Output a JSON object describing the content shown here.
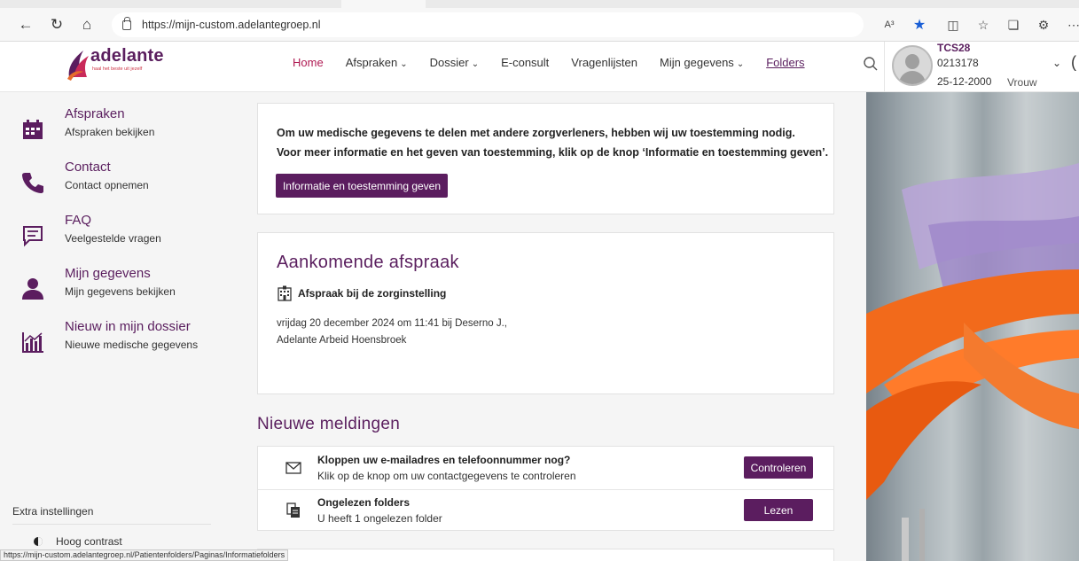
{
  "browser": {
    "url": "https://mijn-custom.adelantegroep.nl",
    "read_aloud_label": "A³"
  },
  "brand": {
    "name": "adelante",
    "tagline": "haal het beste uit jezelf",
    "accent": "#5b1d5f",
    "active_nav": "#b01a53"
  },
  "nav": {
    "home": "Home",
    "afspraken": "Afspraken",
    "dossier": "Dossier",
    "econsult": "E-consult",
    "vragenlijsten": "Vragenlijsten",
    "gegevens": "Mijn gegevens",
    "folders": "Folders"
  },
  "user": {
    "name": "TCS28",
    "id": "0213178",
    "dob": "25-12-2000",
    "gender": "Vrouw"
  },
  "sidebar": {
    "items": [
      {
        "title": "Afspraken",
        "sub": "Afspraken bekijken",
        "icon": "calendar-icon"
      },
      {
        "title": "Contact",
        "sub": "Contact opnemen",
        "icon": "phone-icon"
      },
      {
        "title": "FAQ",
        "sub": "Veelgestelde vragen",
        "icon": "chat-icon"
      },
      {
        "title": "Mijn gegevens",
        "sub": "Mijn gegevens bekijken",
        "icon": "person-icon"
      },
      {
        "title": "Nieuw in mijn dossier",
        "sub": "Nieuwe medische gegevens",
        "icon": "chart-icon"
      }
    ],
    "extra_settings": "Extra instellingen",
    "high_contrast": "Hoog contrast"
  },
  "consent": {
    "line1": "Om uw medische gegevens te delen met andere zorgverleners, hebben wij uw toestemming nodig.",
    "line2": "Voor meer informatie en het geven van toestemming, klik op de knop ‘Informatie en toestemming geven’.",
    "button": "Informatie en toestemming geven"
  },
  "appointment": {
    "title": "Aankomende afspraak",
    "type": "Afspraak bij de zorginstelling",
    "line1": "vrijdag 20 december 2024 om 11:41 bij Deserno J.,",
    "line2": "Adelante Arbeid Hoensbroek"
  },
  "notifications": {
    "title": "Nieuwe meldingen",
    "items": [
      {
        "title": "Kloppen uw e-mailadres en telefoonnummer nog?",
        "sub": "Klik op de knop om uw contactgegevens te controleren",
        "button": "Controleren",
        "icon": "mail-icon"
      },
      {
        "title": "Ongelezen folders",
        "sub": "U heeft 1 ongelezen folder",
        "button": "Lezen",
        "icon": "folders-icon"
      }
    ]
  },
  "status_url": "https://mijn-custom.adelantegroep.nl/Patientenfolders/Paginas/Informatiefolders"
}
